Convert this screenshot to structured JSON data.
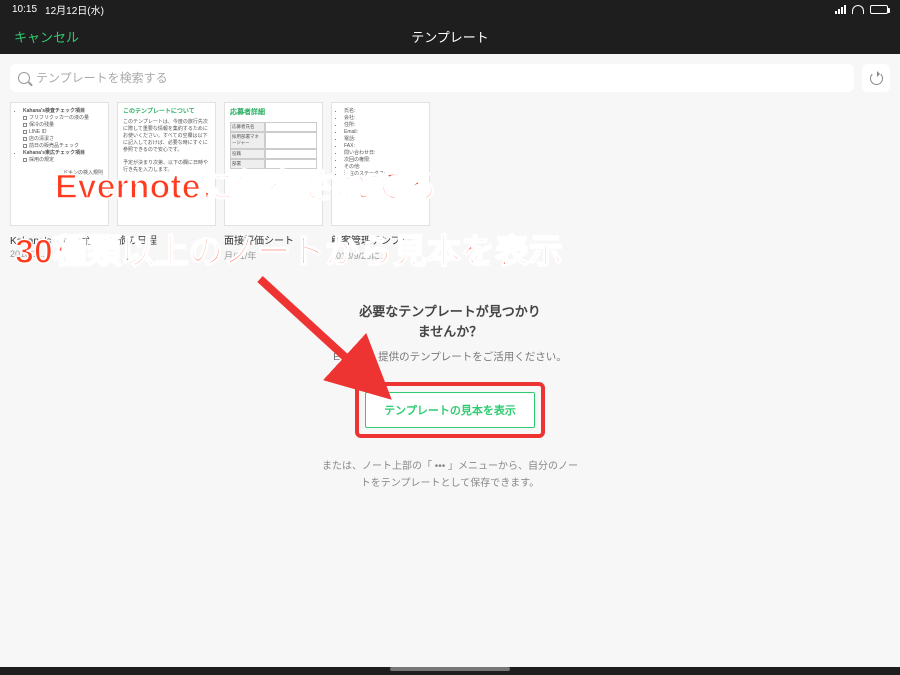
{
  "status": {
    "time": "10:15",
    "date": "12月12日(水)"
  },
  "nav": {
    "cancel": "キャンセル",
    "title": "テンプレート"
  },
  "search": {
    "placeholder": "テンプレートを検索する"
  },
  "templates": [
    {
      "title": "Kahana's　各店舗チェッ...",
      "date": "2018/1..."
    },
    {
      "title": "旅の日程",
      "date": ""
    },
    {
      "title": "面接評価シート",
      "date": "月/11/年"
    },
    {
      "title": "顧客管理テンプレート",
      "date": "2018/9/26に..."
    }
  ],
  "thumb1": {
    "h1": "Kahana's検査チェック項目",
    "items": [
      "フリフリクッカーの液の量",
      "保冷の残量",
      "LINE ID",
      "店の清潔さ",
      "前日の販売品チェック"
    ],
    "h2": "Kahana's東広チェック項目",
    "items2": [
      "採用の規定"
    ],
    "foot": "ドキンの検入規則"
  },
  "thumb2": {
    "h": "このテンプレートについて",
    "p1": "このテンプレートは、今度の旅行先次に際して重要な情報を集約するためにお使いください。すべての空欄は以下に記入しておけば、必要な時にすぐに参照できるので安心です。",
    "p2": "予定が決まり次第、以下の欄に日時や行き先を入力します。"
  },
  "thumb3": {
    "h": "応募者詳細",
    "rows": [
      "応募者氏名",
      "採用部署マネージャー",
      "役職",
      "部署"
    ]
  },
  "thumb4": {
    "items": [
      "氏名:",
      "会社:",
      "住所:",
      "Email:",
      "電話:",
      "FAX:",
      "問い合わせ日:",
      "次回の権限:",
      "その他:",
      "現在のステータス:"
    ]
  },
  "noResults": {
    "heading1": "必要なテンプレートが見つかり",
    "heading2": "ませんか？",
    "sub": "Evernote 提供のテンプレートをご活用ください。",
    "button": "テンプレートの見本を表示",
    "tail": "または、ノート上部の「 ••• 」メニューから、自分のノートをテンプレートとして保存できます。"
  },
  "annotation": {
    "line1": "Evernoteに保存されてる",
    "line2": "30種類以上のノートから見本を表示"
  }
}
